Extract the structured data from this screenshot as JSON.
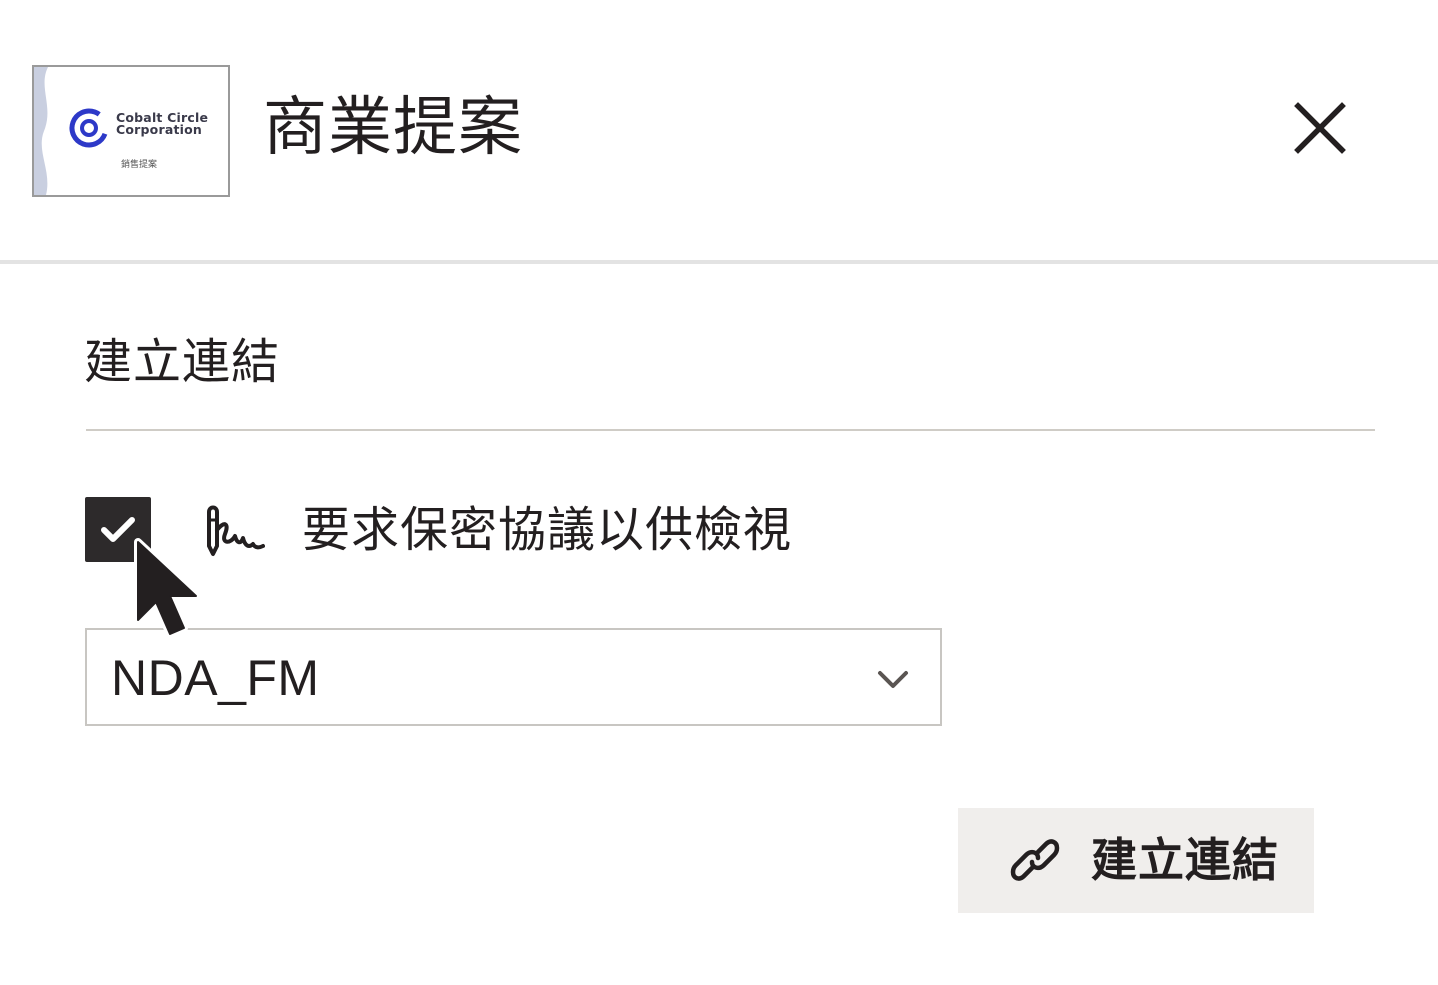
{
  "header": {
    "thumbnail": {
      "company_line1": "Cobalt Circle",
      "company_line2": "Corporation",
      "subtitle": "銷售提案"
    },
    "title": "商業提案",
    "close_icon": "close-icon"
  },
  "section": {
    "title": "建立連結"
  },
  "nda": {
    "checked": true,
    "icon": "signature-icon",
    "label": "要求保密協議以供檢視"
  },
  "dropdown": {
    "selected": "NDA_FM",
    "icon": "chevron-down-icon"
  },
  "create_button": {
    "icon": "link-icon",
    "label": "建立連結"
  },
  "colors": {
    "text": "#231f20",
    "checkbox_fill": "#2d2a2b",
    "button_bg": "#f0eeec",
    "logo_blue": "#2d39c8",
    "divider": "#cfccc6"
  }
}
